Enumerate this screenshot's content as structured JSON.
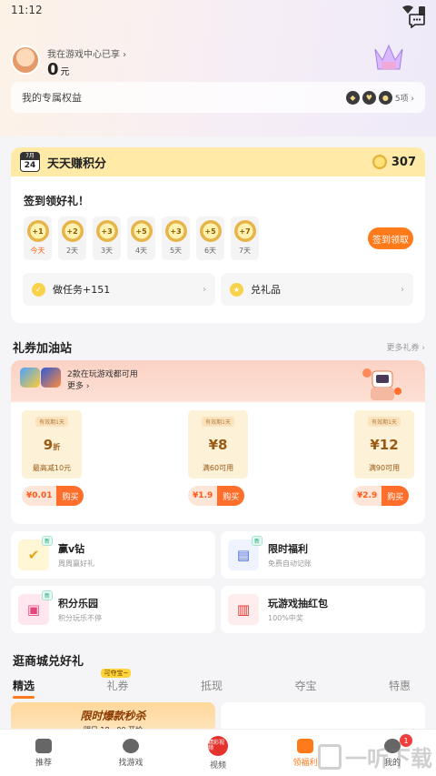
{
  "status": {
    "time": "11:12"
  },
  "user": {
    "link_text": "我在游戏中心已享 ›",
    "points": "0",
    "unit": "元"
  },
  "benefits": {
    "label": "我的专属权益",
    "count_text": "5项 ›"
  },
  "sign": {
    "month": "7月",
    "day": "24",
    "title": "天天赚积分",
    "coin_count": "307",
    "subtitle": "签到领好礼！",
    "days": [
      {
        "value": "+1",
        "label": "今天"
      },
      {
        "value": "+2",
        "label": "2天"
      },
      {
        "value": "+3",
        "label": "3天"
      },
      {
        "value": "+5",
        "label": "4天"
      },
      {
        "value": "+3",
        "label": "5天"
      },
      {
        "value": "+5",
        "label": "6天"
      },
      {
        "value": "+7",
        "label": "7天"
      }
    ],
    "button": "签到领取",
    "task_label": "做任务+151",
    "gift_label": "兑礼品"
  },
  "coupons": {
    "title": "礼券加油站",
    "more": "更多礼券 ›",
    "banner_line1": "2款在玩游戏都可用",
    "banner_line2": "更多 ›",
    "items": [
      {
        "tag": "有效期1天",
        "value": "9",
        "unit": "折",
        "cond": "最高减10元",
        "price": "¥0.01",
        "buy": "购买"
      },
      {
        "tag": "有效期1天",
        "value": "¥8",
        "unit": "",
        "cond": "满60可用",
        "price": "¥1.9",
        "buy": "购买"
      },
      {
        "tag": "有效期1天",
        "value": "¥12",
        "unit": "",
        "cond": "满90可用",
        "price": "¥2.9",
        "buy": "购买"
      }
    ]
  },
  "features": [
    {
      "title": "赢v钻",
      "sub": "周周赢好礼",
      "badge": "新"
    },
    {
      "title": "限时福利",
      "sub": "免费自动记账",
      "badge": "新"
    },
    {
      "title": "积分乐园",
      "sub": "积分玩乐不停",
      "badge": "新"
    },
    {
      "title": "玩游戏抽红包",
      "sub": "100%中奖",
      "badge": ""
    }
  ],
  "mall": {
    "title": "逛商城兑好礼",
    "tabs": [
      "精选",
      "礼券",
      "抵现",
      "夺宝",
      "特惠"
    ],
    "tab_badge": "可夺宝~",
    "flash_title": "限时爆款秒杀",
    "flash_sub": "明日 18 : 00 开抢"
  },
  "nav": [
    {
      "label": "推荐"
    },
    {
      "label": "找游戏"
    },
    {
      "label": "视频",
      "icon_text": "精彩视频"
    },
    {
      "label": "领福利"
    },
    {
      "label": "我的",
      "badge": "1"
    }
  ],
  "watermark": "一听下载"
}
